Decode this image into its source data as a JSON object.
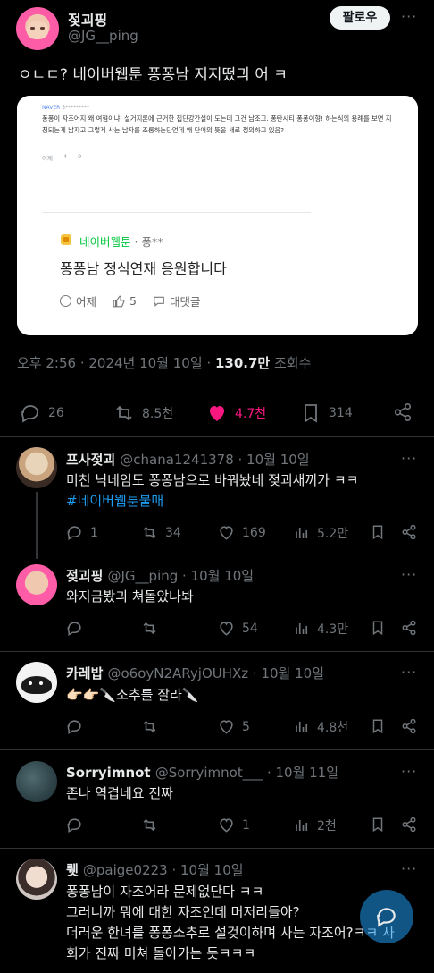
{
  "post": {
    "author_name": "젖괴핑",
    "author_handle": "@JG__ping",
    "follow_label": "팔로우",
    "more_label": "···",
    "text": "ㅇㄴㄷ? 네이버웹툰 퐁퐁남 지지떴긔 어 ㅋ",
    "embed": {
      "source": "NAVER",
      "user": "5*********",
      "comment": "퐁퐁이 자조어지 왜 여혐이냐. 설거지론에 근거한 집단강간설이 도는데 그건 남조고. 퐁탄시티 퐁퐁이형! 하는식의 용례를 보면 지칭되는게 남자고 그렇게 사는 남자를 조롱하는단언데 왜 단어의 뜻을 새로 정의하고 있음?",
      "meta_time": "어제",
      "meta_likes": "4",
      "meta_replies": "9",
      "brand_label": "네이버웹툰",
      "brand_user": "· 퐁**",
      "main_text": "퐁퐁남 정식연재 응원합니다",
      "time_label": "어제",
      "like_count": "5",
      "reply_label": "대댓글"
    },
    "timestamp": "오후 2:56 · 2024년 10월 10일 · ",
    "views_count": "130.7만",
    "views_label": " 조회수",
    "stats": {
      "replies": "26",
      "reposts": "8.5천",
      "likes": "4.7천",
      "bookmarks": "314"
    }
  },
  "colors": {
    "like_active": "#f91880",
    "link": "#1d9bf0",
    "divider": "#2f3336",
    "muted": "#71767b"
  },
  "replies": [
    {
      "name": "프사젖괴",
      "handle": "@chana1241378 · 10월 10일",
      "line1": "미친 닉네임도 퐁퐁남으로 바꿔놨네 젖괴새끼가 ㅋㅋ",
      "hashtag": "#네이버웹툰불매",
      "replies": "1",
      "reposts": "34",
      "likes": "169",
      "views": "5.2만"
    },
    {
      "name": "젖괴핑",
      "handle": "@JG__ping · 10월 10일",
      "line1": "와지금봤긔 쳐돌았나봐",
      "replies": "",
      "reposts": "",
      "likes": "54",
      "views": "4.3만"
    },
    {
      "name": "카레밥",
      "handle": "@o6oyN2ARyjOUHXz · 10월 10일",
      "line1": "👉🏻👉🏻🔪소추를 잘라🔪",
      "replies": "",
      "reposts": "",
      "likes": "5",
      "views": "4.8천"
    },
    {
      "name": "Sorryimnot",
      "handle": "@Sorryimnot___ · 10월 11일",
      "line1": "존나 역겹네요 진짜",
      "replies": "",
      "reposts": "",
      "likes": "1",
      "views": "2천"
    },
    {
      "name": "뤳",
      "handle": "@paige0223 · 10월 10일",
      "line1": "퐁퐁남이 자조어라 문제없단다 ㅋㅋ",
      "line2": "그러니까 뭐에 대한 자조인데 머저리들아?",
      "line3": "더러운 한녀를 퐁퐁소추로 설겆이하며 사는 자조어?ㅋㅋ 사",
      "line4": "회가 진짜 미쳐 돌아가는 듯ㅋㅋㅋ"
    }
  ]
}
